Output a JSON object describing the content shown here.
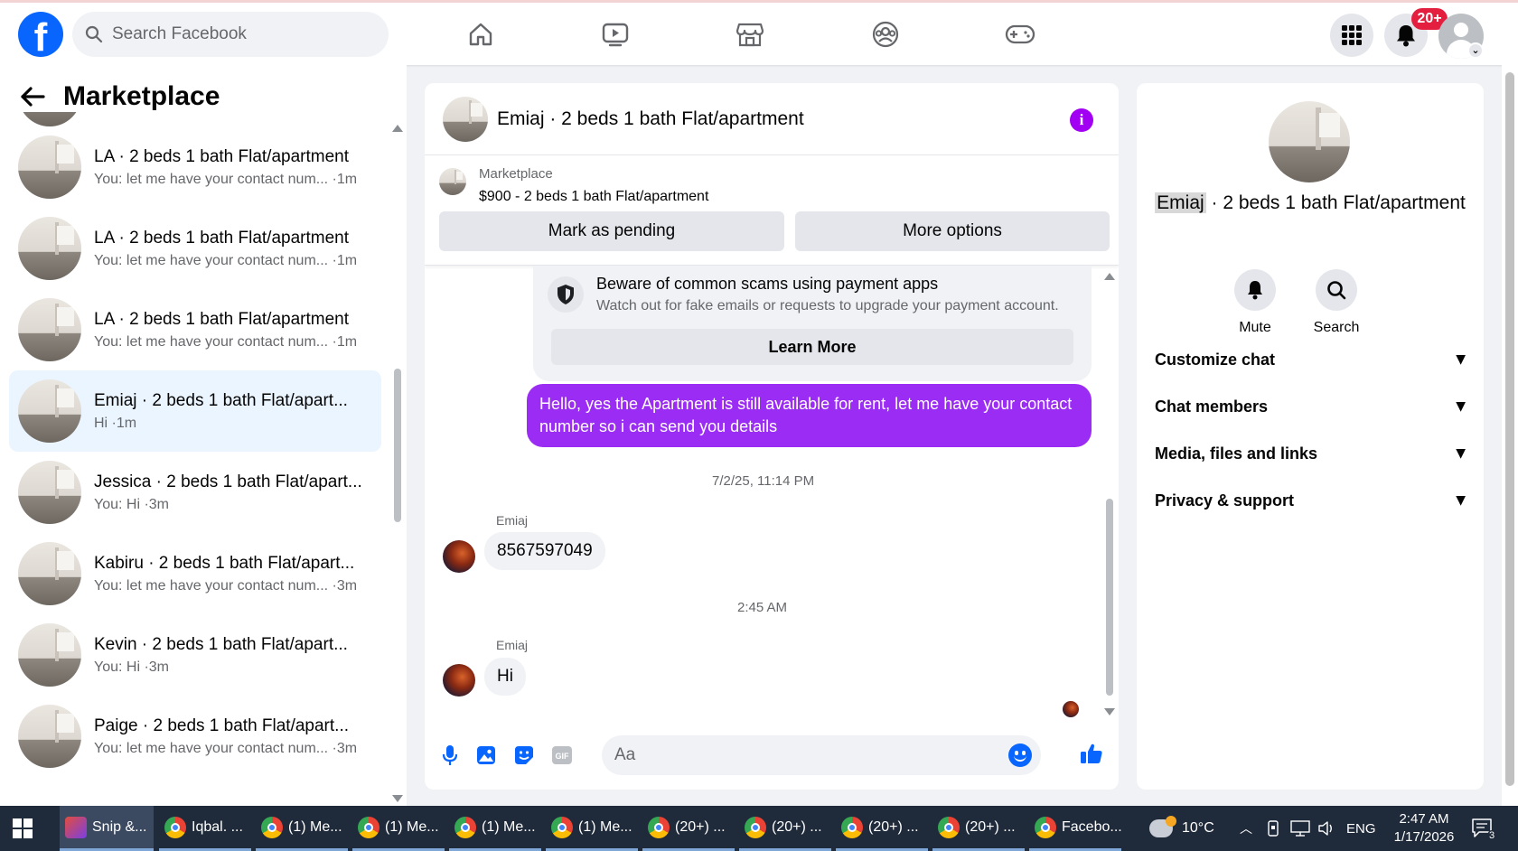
{
  "nav": {
    "search_placeholder": "Search Facebook",
    "notif_count": "20+"
  },
  "sidebar": {
    "title": "Marketplace",
    "conversations": [
      {
        "name": "LA · 2 beds 1 bath Flat/apartment",
        "last": "You: let me have your contact num... ·1m"
      },
      {
        "name": "LA · 2 beds 1 bath Flat/apartment",
        "last": "You: let me have your contact num... ·1m"
      },
      {
        "name": "LA · 2 beds 1 bath Flat/apartment",
        "last": "You: let me have your contact num... ·1m"
      },
      {
        "name": "Emiaj · 2 beds 1 bath Flat/apart...",
        "last": "Hi ·1m",
        "active": true
      },
      {
        "name": "Jessica · 2 beds 1 bath Flat/apart...",
        "last": "You: Hi ·3m"
      },
      {
        "name": "Kabiru · 2 beds 1 bath Flat/apart...",
        "last": "You: let me have your contact num... ·3m"
      },
      {
        "name": "Kevin · 2 beds 1 bath Flat/apart...",
        "last": "You: Hi ·3m"
      },
      {
        "name": "Paige · 2 beds 1 bath Flat/apart...",
        "last": "You: let me have your contact num... ·3m"
      }
    ]
  },
  "chat": {
    "title": "Emiaj · 2 beds 1 bath Flat/apartment",
    "listing_source": "Marketplace",
    "listing_price": "$900 - 2 beds 1 bath Flat/apartment",
    "btn_pending": "Mark as pending",
    "btn_more": "More options",
    "scam_title": "Beware of common scams using payment apps",
    "scam_sub": "Watch out for fake emails or requests to upgrade your payment account.",
    "learn_more": "Learn More",
    "outgoing": "Hello, yes the Apartment is still available for rent, let me have your contact number so i can send you details",
    "ts1": "7/2/25, 11:14 PM",
    "sender1": "Emiaj",
    "msg1": "8567597049",
    "ts2": "2:45 AM",
    "sender2": "Emiaj",
    "msg2": "Hi",
    "composer_placeholder": "Aa"
  },
  "rpanel": {
    "title_highlight": "Emiaj",
    "title_rest": " · 2 beds 1 bath Flat/apartment",
    "mute": "Mute",
    "search": "Search",
    "sections": [
      "Customize chat",
      "Chat members",
      "Media, files and links",
      "Privacy & support"
    ]
  },
  "taskbar": {
    "items": [
      "Snip &...",
      "Iqbal. ...",
      "(1) Me...",
      "(1) Me...",
      "(1) Me...",
      "(1) Me...",
      "(20+) ...",
      "(20+) ...",
      "(20+) ...",
      "(20+) ...",
      "Facebo..."
    ],
    "temp": "10°C",
    "lang": "ENG",
    "time": "2:47 AM",
    "date": "1/17/2026",
    "notif_count": "3"
  },
  "colors": {
    "brand": "#0866ff",
    "outgoing_bubble": "#9b2cf3",
    "info": "#a100f2",
    "badge": "#e41e3f"
  }
}
